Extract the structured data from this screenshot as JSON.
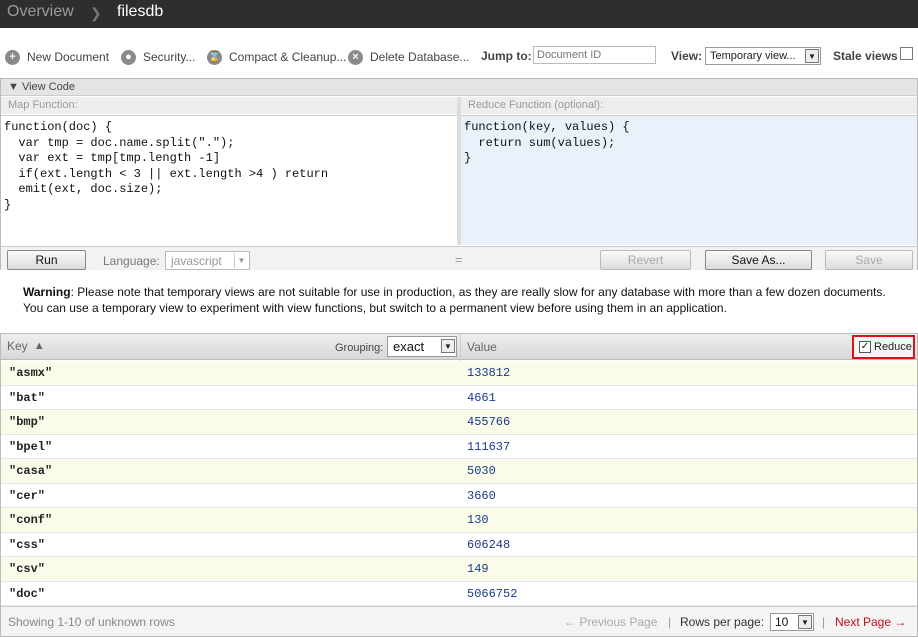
{
  "breadcrumb": {
    "overview": "Overview",
    "database": "filesdb"
  },
  "toolbar": {
    "new_document": "New Document",
    "security": "Security...",
    "compact": "Compact & Cleanup...",
    "delete_db": "Delete Database...",
    "jump_to_label": "Jump to:",
    "doc_id_placeholder": "Document ID",
    "view_label": "View:",
    "view_selected": "Temporary view...",
    "stale_views_label": "Stale views"
  },
  "code": {
    "view_code_label": "View Code",
    "map_header": "Map Function:",
    "reduce_header": "Reduce Function (optional):",
    "map_function": "function(doc) {\n  var tmp = doc.name.split(\".\");\n  var ext = tmp[tmp.length -1]\n  if(ext.length < 3 || ext.length >4 ) return\n  emit(ext, doc.size);\n}",
    "reduce_function": "function(key, values) {\n  return sum(values);\n}",
    "run_label": "Run",
    "language_label": "Language:",
    "language_selected": "javascript",
    "eq_sign": "=",
    "revert_label": "Revert",
    "save_as_label": "Save As...",
    "save_label": "Save"
  },
  "warning": {
    "bold": "Warning",
    "text": ": Please note that temporary views are not suitable for use in production, as they are really slow for any database with more than a few dozen documents. You can use a temporary view to experiment with view functions, but switch to a permanent view before using them in an application."
  },
  "results": {
    "key_header": "Key",
    "grouping_label": "Grouping:",
    "grouping_selected": "exact",
    "value_header": "Value",
    "reduce_label": "Reduce",
    "reduce_checked": true,
    "rows": [
      {
        "key": "\"asmx\"",
        "value": "133812"
      },
      {
        "key": "\"bat\"",
        "value": "4661"
      },
      {
        "key": "\"bmp\"",
        "value": "455766"
      },
      {
        "key": "\"bpel\"",
        "value": "111637"
      },
      {
        "key": "\"casa\"",
        "value": "5030"
      },
      {
        "key": "\"cer\"",
        "value": "3660"
      },
      {
        "key": "\"conf\"",
        "value": "130"
      },
      {
        "key": "\"css\"",
        "value": "606248"
      },
      {
        "key": "\"csv\"",
        "value": "149"
      },
      {
        "key": "\"doc\"",
        "value": "5066752"
      }
    ],
    "showing": "Showing 1-10 of unknown rows",
    "prev_page": "← Previous Page",
    "rows_per_page_label": "Rows per page:",
    "rows_per_page": "10",
    "next_page": "Next Page →"
  },
  "colors": {
    "topbar": "#2e2e2e",
    "accent_red": "#e0101b",
    "reduce_bg": "#e9f2fb"
  }
}
